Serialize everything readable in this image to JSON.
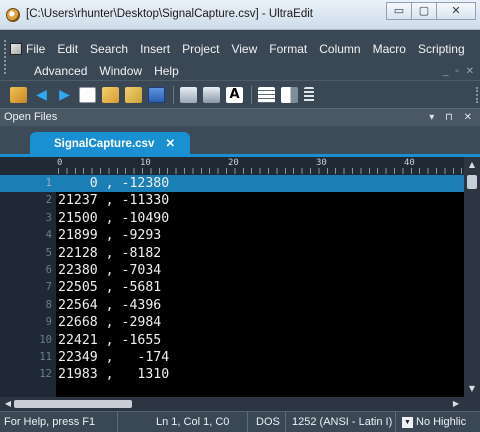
{
  "window": {
    "title": "[C:\\Users\\rhunter\\Desktop\\SignalCapture.csv] - UltraEdit",
    "controls": {
      "minimize": "▭",
      "maximize": "▢",
      "close": "✕"
    }
  },
  "menubar": {
    "row1": [
      "File",
      "Edit",
      "Search",
      "Insert",
      "Project",
      "View",
      "Format",
      "Column",
      "Macro",
      "Scripting"
    ],
    "row2": [
      "Advanced",
      "Window",
      "Help"
    ],
    "mdi_controls": "_ ▫ ✕"
  },
  "toolbar": {
    "icons": [
      "open-folder-icon",
      "back-arrow-icon",
      "forward-arrow-icon",
      "new-file-icon",
      "open-file-icon",
      "folder-icon",
      "save-icon",
      "print-icon",
      "print-preview-icon",
      "font-icon",
      "list-icon",
      "panel-icon",
      "spell-check-icon"
    ],
    "colors": {
      "accent": "#1a8fd1",
      "arrow": "#2ea8f0",
      "folder": "#e8b84a",
      "save": "#3a7bd5"
    }
  },
  "open_files_panel": {
    "label": "Open Files",
    "controls": "▾ ⊓ ✕"
  },
  "tabs": [
    {
      "label": "SignalCapture.csv",
      "close": "✕"
    }
  ],
  "ruler": {
    "labels": [
      "0",
      "10",
      "20",
      "30",
      "40"
    ]
  },
  "editor": {
    "current_line": 1,
    "lines": [
      {
        "n": "1",
        "text": "    0 , -12380"
      },
      {
        "n": "2",
        "text": "21237 , -11330"
      },
      {
        "n": "3",
        "text": "21500 , -10490"
      },
      {
        "n": "4",
        "text": "21899 , -9293"
      },
      {
        "n": "5",
        "text": "22128 , -8182"
      },
      {
        "n": "6",
        "text": "22380 , -7034"
      },
      {
        "n": "7",
        "text": "22505 , -5681"
      },
      {
        "n": "8",
        "text": "22564 , -4396"
      },
      {
        "n": "9",
        "text": "22668 , -2984"
      },
      {
        "n": "10",
        "text": "22421 , -1655"
      },
      {
        "n": "11",
        "text": "22349 ,   -174"
      },
      {
        "n": "12",
        "text": "21983 ,   1310"
      }
    ]
  },
  "statusbar": {
    "help": "For Help, press F1",
    "position": "Ln 1, Col 1, C0",
    "line_ending": "DOS",
    "encoding": "1252  (ANSI - Latin I)",
    "highlighting": "No Highlic"
  }
}
